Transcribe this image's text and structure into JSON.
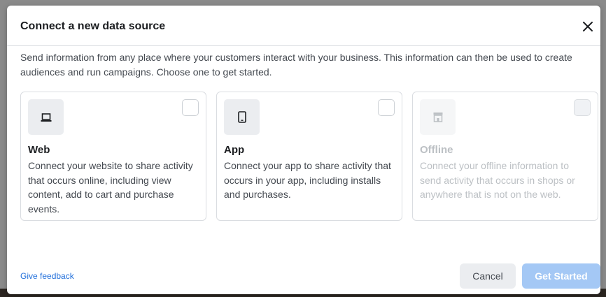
{
  "dialog": {
    "title": "Connect a new data source",
    "description": "Send information from any place where your customers interact with your business. This information can then be used to create audiences and run campaigns. Choose one to get started.",
    "close_icon": "close-icon"
  },
  "cards": [
    {
      "name": "Web",
      "body": "Connect your website to share activity that occurs online, including view content, add to cart and purchase events.",
      "icon": "laptop-icon",
      "checked": false,
      "disabled": false
    },
    {
      "name": "App",
      "body": "Connect your app to share activity that occurs in your app, including installs and purchases.",
      "icon": "phone-icon",
      "checked": false,
      "disabled": false
    },
    {
      "name": "Offline",
      "body": "Connect your offline information to send activity that occurs in shops or anywhere that is not on the web.",
      "icon": "store-icon",
      "checked": false,
      "disabled": true
    }
  ],
  "footer": {
    "feedback_link": "Give feedback",
    "cancel_label": "Cancel",
    "get_started_label": "Get Started"
  },
  "colors": {
    "link": "#216fdb",
    "primary_disabled": "#a4c8f5",
    "text_primary": "#1c1e21",
    "text_secondary": "#444950",
    "text_disabled": "#bcc0c4"
  }
}
